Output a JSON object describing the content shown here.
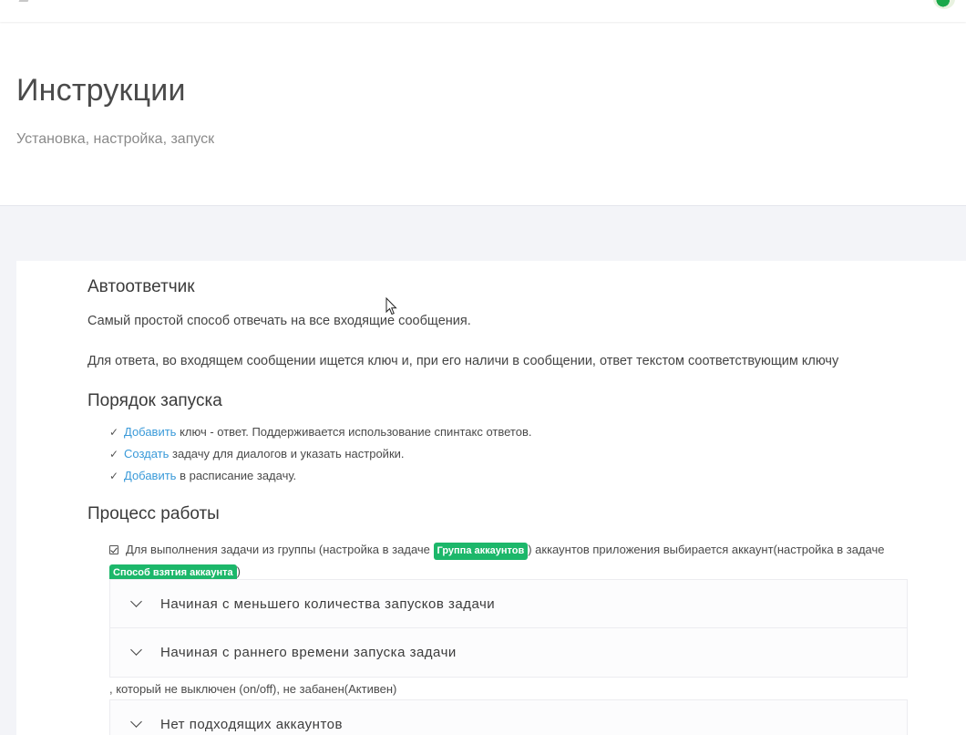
{
  "header": {
    "title": "Инструкции",
    "subtitle": "Установка, настройка, запуск"
  },
  "section": {
    "title": "Автоответчик",
    "intro": "Самый простой способ отвечать на все входящие сообщения.",
    "description": "Для ответа, во входящем сообщении ищется ключ и, при его наличи в сообщении, ответ текстом соответствующим ключу"
  },
  "launch": {
    "title": "Порядок запуска",
    "steps": [
      {
        "link": "Добавить",
        "text": " ключ - ответ. Поддерживается использование спинтакс ответов."
      },
      {
        "link": "Создать",
        "text": " задачу для диалогов и указать настройки."
      },
      {
        "link": "Добавить",
        "text": " в расписание задачу."
      }
    ]
  },
  "process": {
    "title": "Процесс работы",
    "item_text_1": "Для выполнения задачи из группы (настройка в задаче ",
    "badge_1": "Группа аккаунтов",
    "item_text_2": ") аккаунтов приложения выбирается аккаунт(настройка в задаче ",
    "badge_2": "Способ взятия аккаунта",
    "item_text_3": ")",
    "accordion_1": [
      "Начиная с меньшего количества запусков задачи",
      "Начиная с раннего времени запуска задачи"
    ],
    "note": ", который не выключен (on/off), не забанен(Активен)",
    "accordion_2": [
      "Нет подходящих аккаунтов"
    ]
  },
  "colors": {
    "link": "#3a9ad9",
    "badge": "#1cb76a",
    "background": "#f3f4f8"
  }
}
